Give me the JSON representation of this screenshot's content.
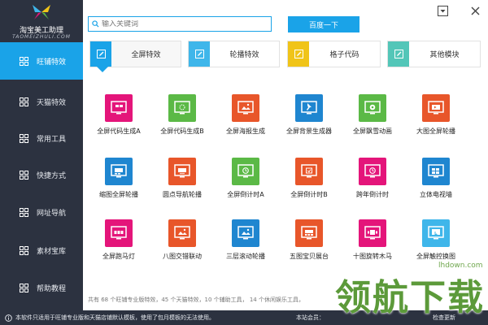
{
  "app": {
    "title": "淘宝美工助理",
    "subtitle": "TAOMEIZHULI.COM"
  },
  "sidebar": {
    "items": [
      {
        "label": "旺铺特效",
        "icon": "grid-icon",
        "active": true
      },
      {
        "label": "天猫特效",
        "icon": "grid-icon",
        "active": false
      },
      {
        "label": "常用工具",
        "icon": "grid-icon",
        "active": false
      },
      {
        "label": "快捷方式",
        "icon": "grid-icon",
        "active": false
      },
      {
        "label": "网址导航",
        "icon": "grid-icon",
        "active": false
      },
      {
        "label": "素材宝库",
        "icon": "grid-icon",
        "active": false
      },
      {
        "label": "帮助教程",
        "icon": "grid-icon",
        "active": false
      }
    ]
  },
  "search": {
    "placeholder": "输入关键词",
    "button_label": "百度一下"
  },
  "categories": [
    {
      "label": "全屏特效",
      "color": "#1aa3e8",
      "active": true
    },
    {
      "label": "轮播特效",
      "color": "#3fb6ea",
      "active": false
    },
    {
      "label": "格子代码",
      "color": "#f0c419",
      "active": false
    },
    {
      "label": "其他模块",
      "color": "#53c6b8",
      "active": false
    }
  ],
  "tools": [
    {
      "label": "全屏代码生成A",
      "color": "#e4157a",
      "icon": "monitor-grid-icon"
    },
    {
      "label": "全屏代码生成B",
      "color": "#5bb946",
      "icon": "monitor-loading-icon"
    },
    {
      "label": "全屏海报生成",
      "color": "#e8562a",
      "icon": "monitor-picture-icon"
    },
    {
      "label": "全屏背景生成器",
      "color": "#1f86d0",
      "icon": "monitor-pin-icon"
    },
    {
      "label": "全屏飘雪动画",
      "color": "#5bb946",
      "icon": "monitor-snowflake-icon"
    },
    {
      "label": "大图全屏轮播",
      "color": "#e8562a",
      "icon": "monitor-slides-icon"
    },
    {
      "label": "缩图全屏轮播",
      "color": "#1f86d0",
      "icon": "monitor-thumbs-icon"
    },
    {
      "label": "圆点导航轮播",
      "color": "#e8562a",
      "icon": "monitor-dots-icon"
    },
    {
      "label": "全屏倒计时A",
      "color": "#5bb946",
      "icon": "monitor-clock-icon"
    },
    {
      "label": "全屏倒计时B",
      "color": "#e8562a",
      "icon": "monitor-timer-icon"
    },
    {
      "label": "跨年倒计时",
      "color": "#e4157a",
      "icon": "monitor-clock-icon"
    },
    {
      "label": "立体电视墙",
      "color": "#1f86d0",
      "icon": "monitor-wall-icon"
    },
    {
      "label": "全屏跑马灯",
      "color": "#e4157a",
      "icon": "monitor-marquee-icon"
    },
    {
      "label": "八图交错联动",
      "color": "#e8562a",
      "icon": "monitor-picture-icon"
    },
    {
      "label": "三层滚动轮播",
      "color": "#1f86d0",
      "icon": "monitor-picture-icon"
    },
    {
      "label": "五图宝贝展台",
      "color": "#e8562a",
      "icon": "monitor-gallery-icon"
    },
    {
      "label": "十图旋转木马",
      "color": "#e4157a",
      "icon": "monitor-carousel-icon"
    },
    {
      "label": "全屏触控换图",
      "color": "#3fb6ea",
      "icon": "monitor-touch-icon"
    }
  ],
  "stats": "共有 68 个旺铺专业版特效，45 个天猫特效，10 个辅助工具， 14 个休闲娱乐工具，",
  "footer": {
    "notice": "本软件只适用于旺铺专业版和天猫店铺默认模板，使用了包月模板的无法使用。",
    "member": "本站会员：",
    "check_update": "检查更新"
  },
  "watermark": {
    "text": "领航下载",
    "site": "lhdown.com"
  }
}
